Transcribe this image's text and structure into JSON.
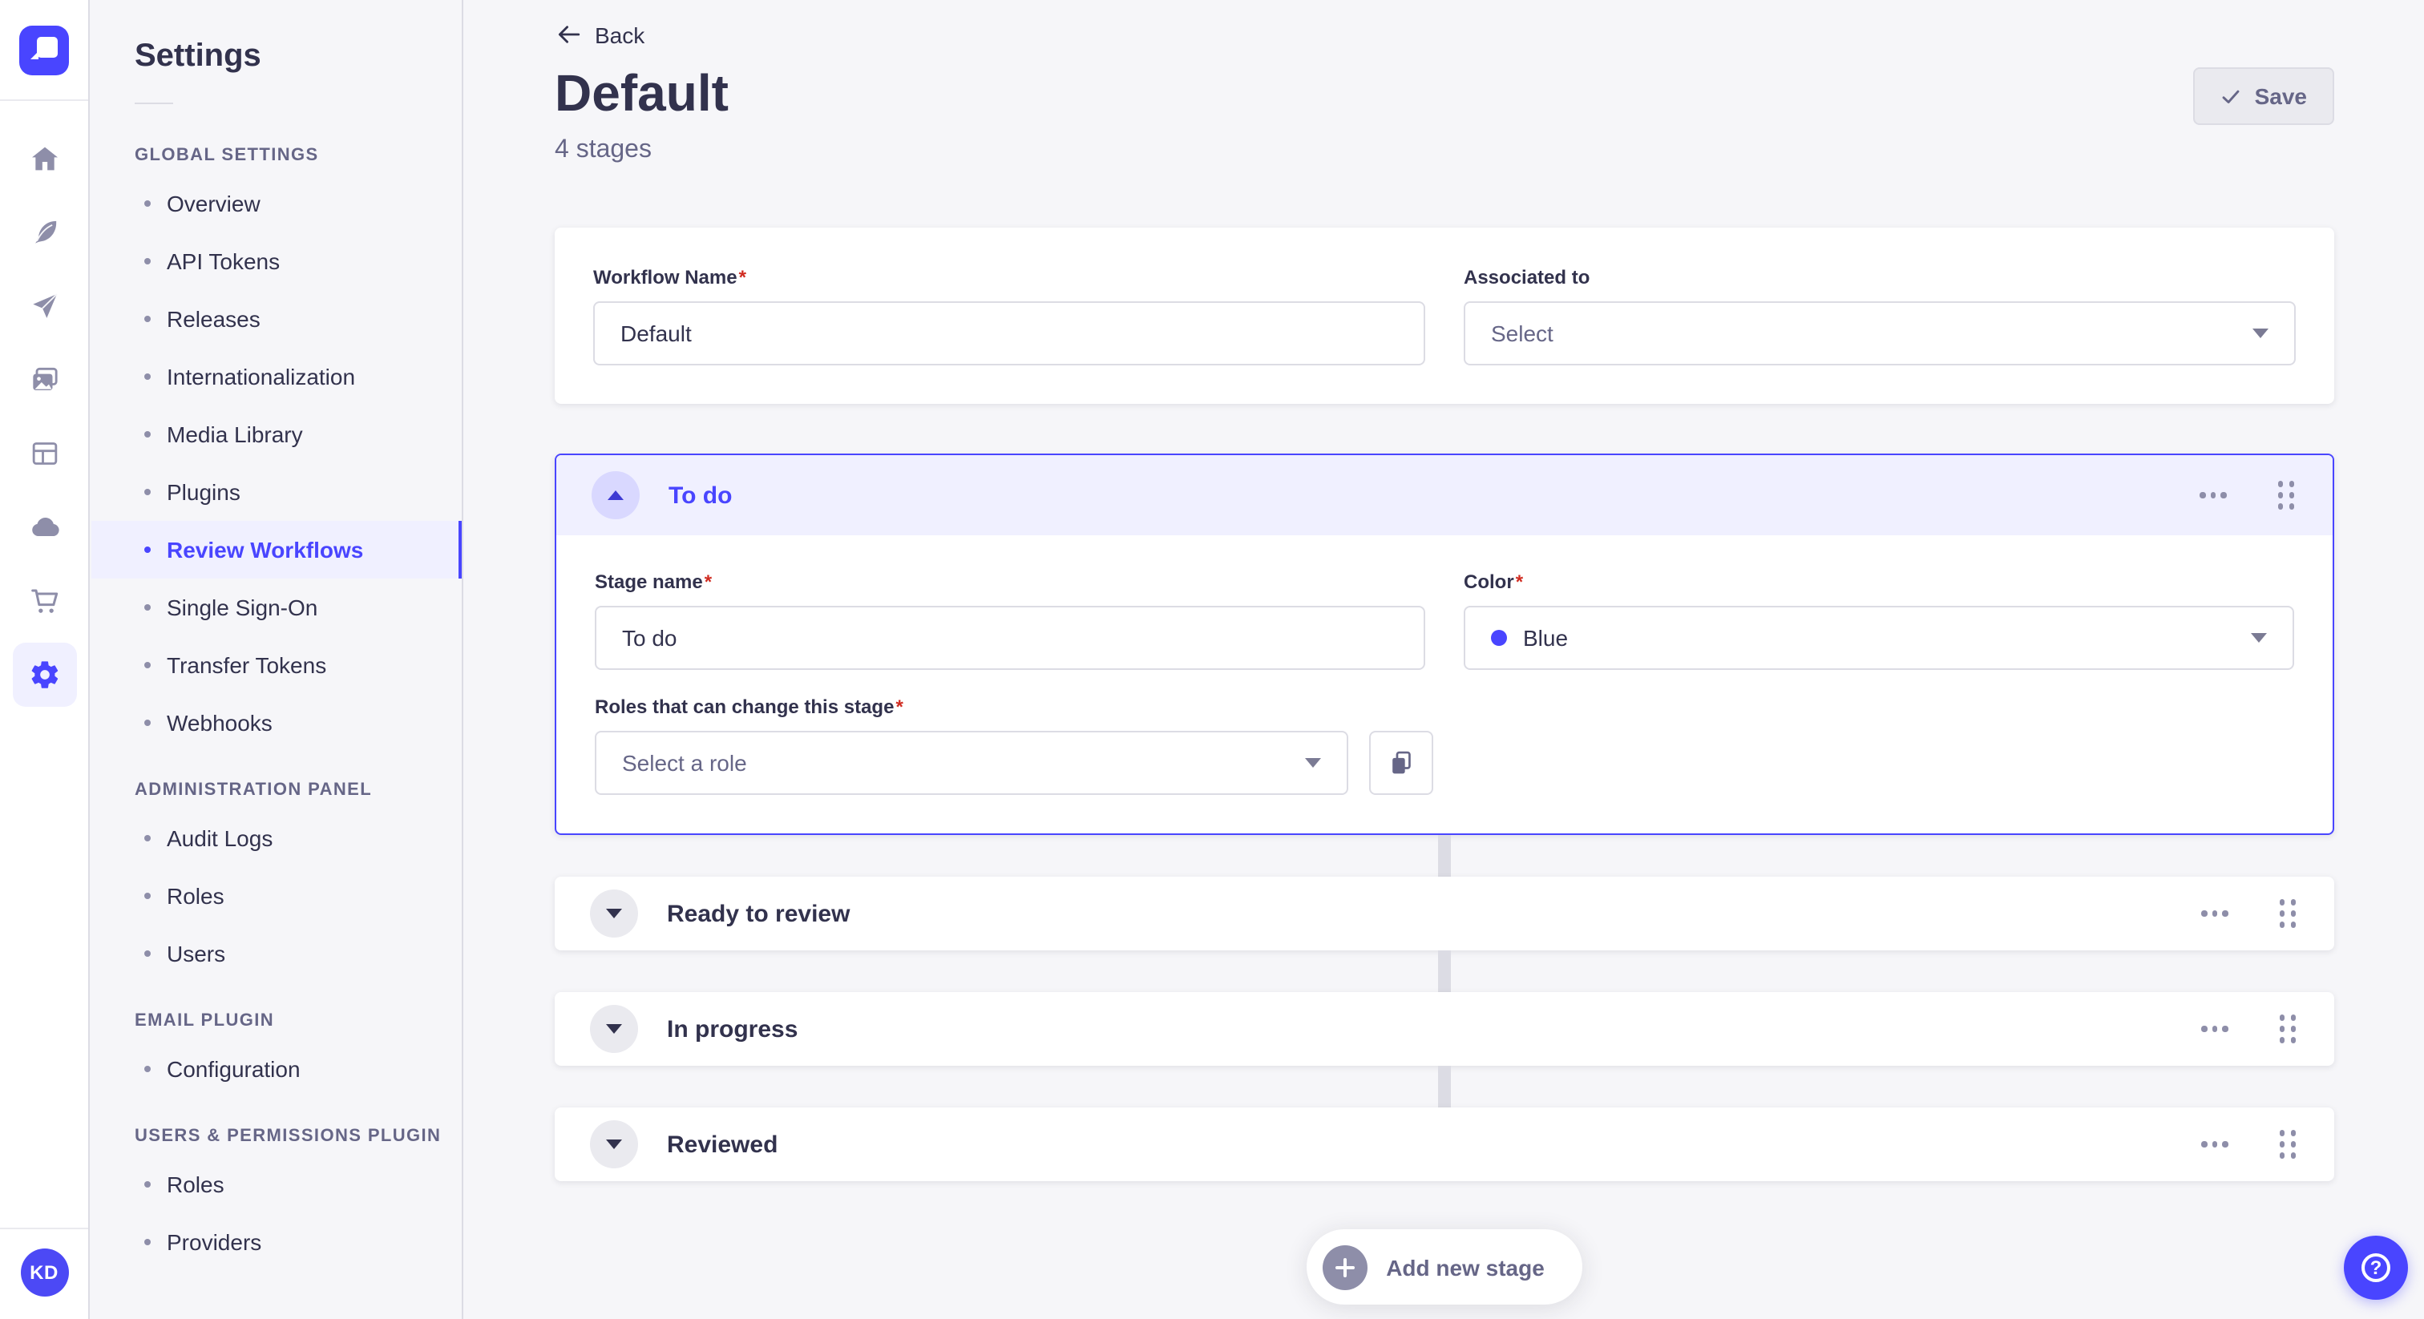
{
  "required_marker": "*",
  "colors": {
    "accent": "#4945FF",
    "accent_light": "#F0F0FF",
    "stage_color_hex": "#4945FF",
    "background": "#F6F6F9"
  },
  "rail": {
    "avatar_initials": "KD"
  },
  "sidebar": {
    "title": "Settings",
    "sections": [
      {
        "label": "GLOBAL SETTINGS",
        "items": [
          "Overview",
          "API Tokens",
          "Releases",
          "Internationalization",
          "Media Library",
          "Plugins",
          "Review Workflows",
          "Single Sign-On",
          "Transfer Tokens",
          "Webhooks"
        ],
        "active_item": "Review Workflows"
      },
      {
        "label": "ADMINISTRATION PANEL",
        "items": [
          "Audit Logs",
          "Roles",
          "Users"
        ]
      },
      {
        "label": "EMAIL PLUGIN",
        "items": [
          "Configuration"
        ]
      },
      {
        "label": "USERS & PERMISSIONS PLUGIN",
        "items": [
          "Roles",
          "Providers"
        ]
      }
    ]
  },
  "header": {
    "back": "Back",
    "title": "Default",
    "subtitle": "4 stages",
    "save": "Save"
  },
  "workflow_card": {
    "name_label": "Workflow Name",
    "name_value": "Default",
    "assoc_label": "Associated to",
    "assoc_value": "Select"
  },
  "stage_expanded": {
    "title": "To do",
    "name_label": "Stage name",
    "name_value": "To do",
    "color_label": "Color",
    "color_value": "Blue",
    "roles_label": "Roles that can change this stage",
    "roles_placeholder": "Select a role"
  },
  "stages_collapsed": [
    {
      "title": "Ready to review"
    },
    {
      "title": "In progress"
    },
    {
      "title": "Reviewed"
    }
  ],
  "add_stage": {
    "label": "Add new stage"
  },
  "help_fab": {
    "glyph": "?"
  }
}
